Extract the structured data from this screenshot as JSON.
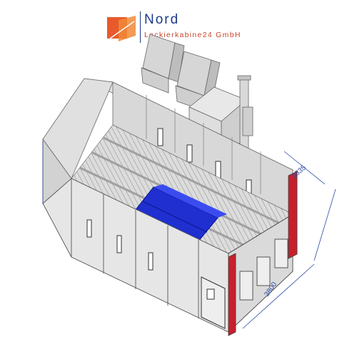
{
  "logo": {
    "name": "Nord",
    "subtitle": "Lackierkabine24 GmbH",
    "accent_color": "#e85a2c",
    "brand_color": "#1c3a8a"
  },
  "drawing": {
    "dimension_height": "2835",
    "dimension_depth": "3800",
    "wall_color": "#e4e4e4",
    "frame_color": "#c8202a",
    "grid_color": "#9a9a9a",
    "pit_color": "#1f2fd0"
  }
}
